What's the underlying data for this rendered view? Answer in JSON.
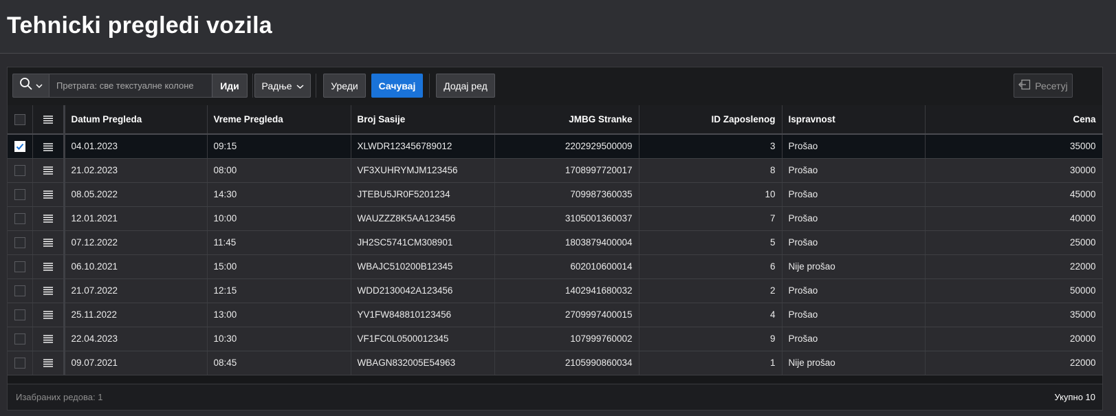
{
  "page": {
    "title": "Tehnicki pregledi vozila"
  },
  "toolbar": {
    "search_placeholder": "Претрага: све текстуалне колоне",
    "go_label": "Иди",
    "actions_label": "Радње",
    "edit_label": "Уреди",
    "save_label": "Сачувај",
    "add_row_label": "Додај ред",
    "reset_label": "Ресетуј"
  },
  "grid": {
    "columns": [
      "Datum Pregleda",
      "Vreme Pregleda",
      "Broj Sasije",
      "JMBG Stranke",
      "ID Zaposlenog",
      "Ispravnost",
      "Cena"
    ],
    "rows": [
      {
        "selected": true,
        "datum": "04.01.2023",
        "vreme": "09:15",
        "sasija": "XLWDR123456789012",
        "jmbg": "2202929500009",
        "zaposleni": "3",
        "ispravnost": "Prošao",
        "cena": "35000"
      },
      {
        "selected": false,
        "datum": "21.02.2023",
        "vreme": "08:00",
        "sasija": "VF3XUHRYMJM123456",
        "jmbg": "1708997720017",
        "zaposleni": "8",
        "ispravnost": "Prošao",
        "cena": "30000"
      },
      {
        "selected": false,
        "datum": "08.05.2022",
        "vreme": "14:30",
        "sasija": "JTEBU5JR0F5201234",
        "jmbg": "709987360035",
        "zaposleni": "10",
        "ispravnost": "Prošao",
        "cena": "45000"
      },
      {
        "selected": false,
        "datum": "12.01.2021",
        "vreme": "10:00",
        "sasija": "WAUZZZ8K5AA123456",
        "jmbg": "3105001360037",
        "zaposleni": "7",
        "ispravnost": "Prošao",
        "cena": "40000"
      },
      {
        "selected": false,
        "datum": "07.12.2022",
        "vreme": "11:45",
        "sasija": "JH2SC5741CM308901",
        "jmbg": "1803879400004",
        "zaposleni": "5",
        "ispravnost": "Prošao",
        "cena": "25000"
      },
      {
        "selected": false,
        "datum": "06.10.2021",
        "vreme": "15:00",
        "sasija": "WBAJC510200B12345",
        "jmbg": "602010600014",
        "zaposleni": "6",
        "ispravnost": "Nije prošao",
        "cena": "22000"
      },
      {
        "selected": false,
        "datum": "21.07.2022",
        "vreme": "12:15",
        "sasija": "WDD2130042A123456",
        "jmbg": "1402941680032",
        "zaposleni": "2",
        "ispravnost": "Prošao",
        "cena": "50000"
      },
      {
        "selected": false,
        "datum": "25.11.2022",
        "vreme": "13:00",
        "sasija": "YV1FW848810123456",
        "jmbg": "2709997400015",
        "zaposleni": "4",
        "ispravnost": "Prošao",
        "cena": "35000"
      },
      {
        "selected": false,
        "datum": "22.04.2023",
        "vreme": "10:30",
        "sasija": "VF1FC0L0500012345",
        "jmbg": "107999760002",
        "zaposleni": "9",
        "ispravnost": "Prošao",
        "cena": "20000"
      },
      {
        "selected": false,
        "datum": "09.07.2021",
        "vreme": "08:45",
        "sasija": "WBAGN832005E54963",
        "jmbg": "2105990860034",
        "zaposleni": "1",
        "ispravnost": "Nije prošao",
        "cena": "22000"
      }
    ]
  },
  "footer": {
    "selected_rows": "Изабраних редова: 1",
    "total": "Укупно 10"
  },
  "colors": {
    "accent": "#1a73d9",
    "background": "#2b2b2f",
    "selected_row": "#0f1318"
  }
}
